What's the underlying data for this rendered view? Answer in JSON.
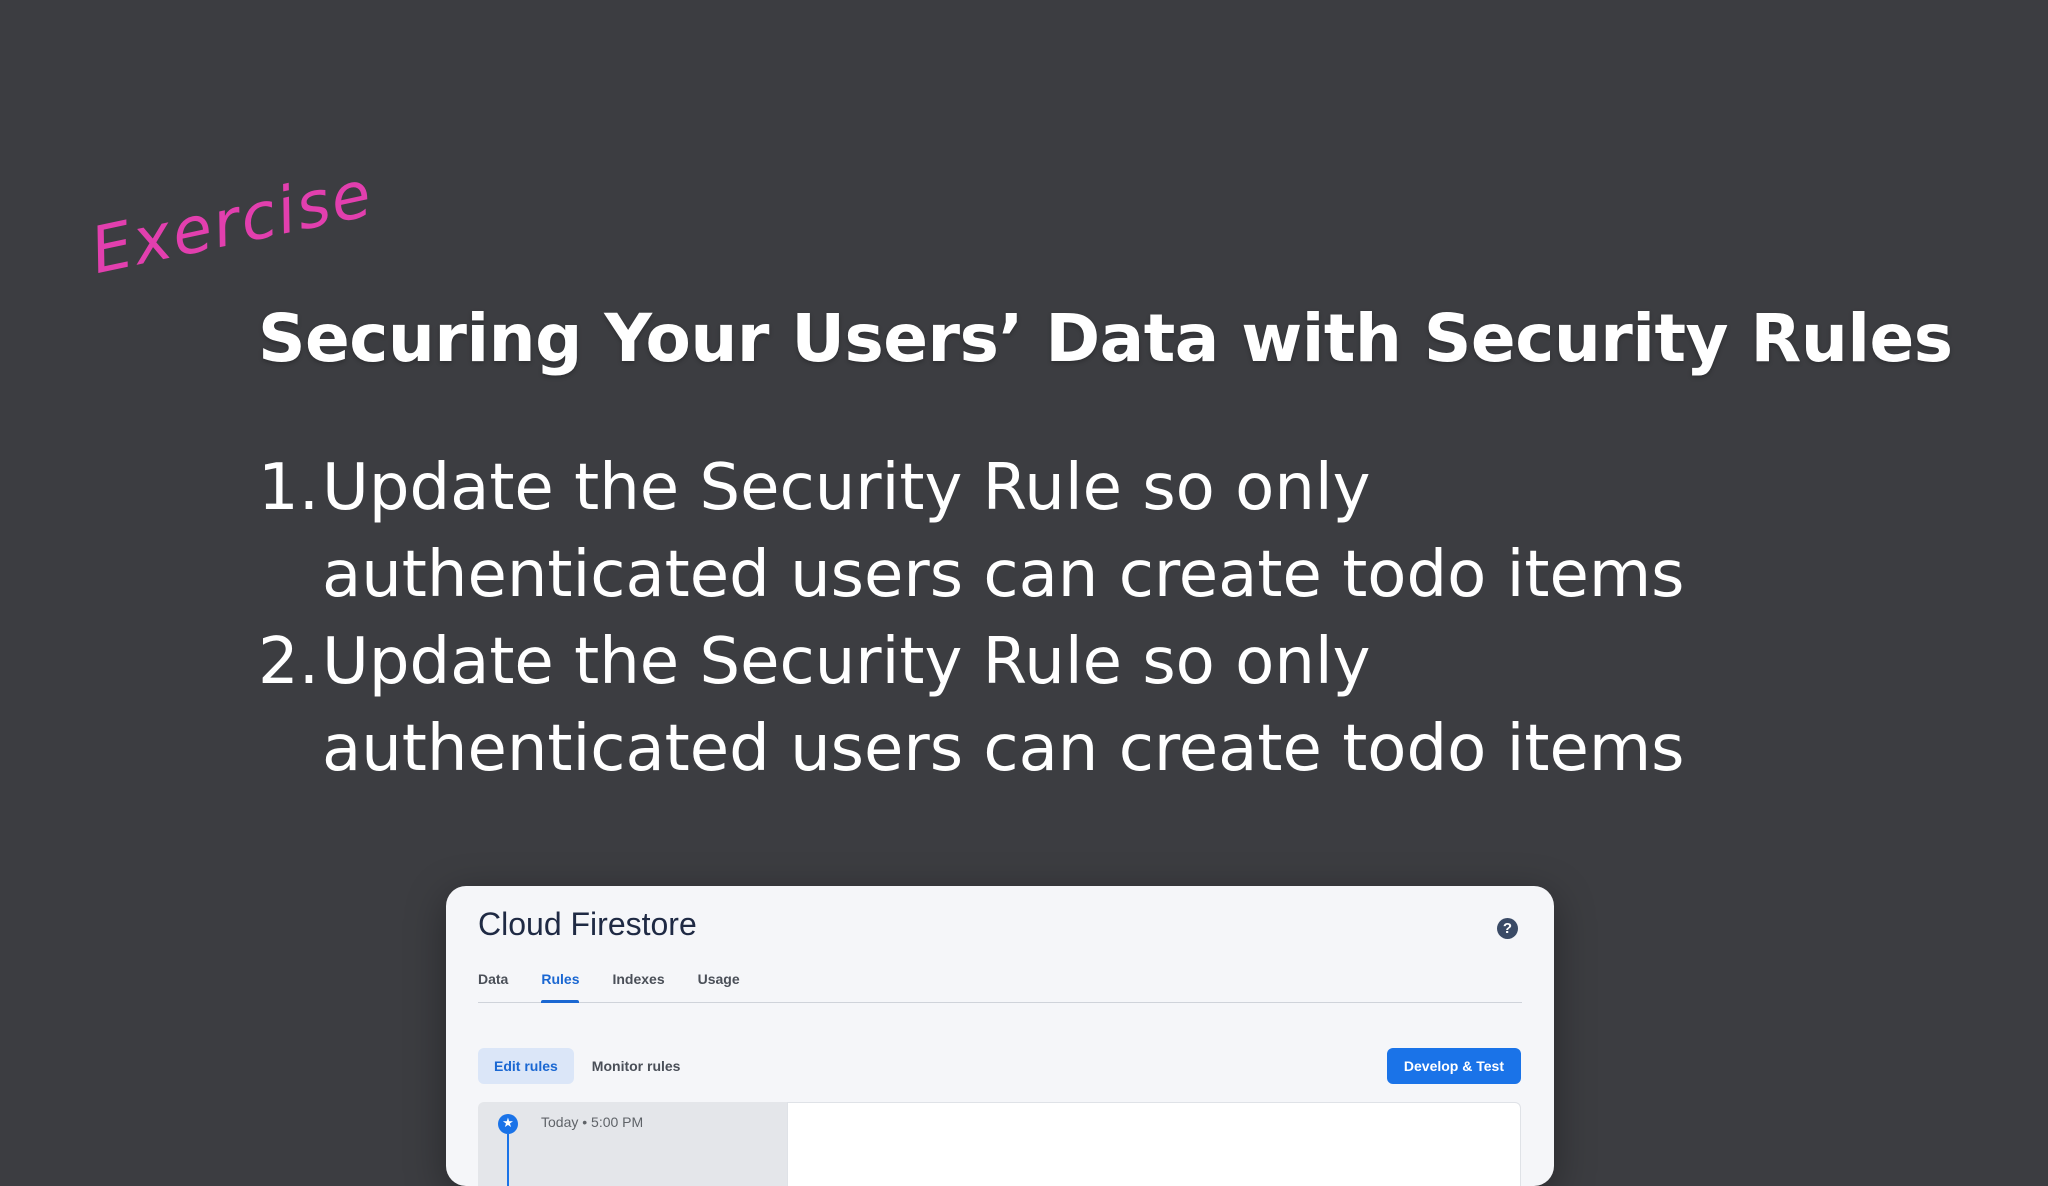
{
  "slide": {
    "tag": "Exercise",
    "title": "Securing Your Users’ Data with Security Rules",
    "steps": [
      {
        "number": "1.",
        "text": "Update the Security Rule so only authenticated users can create todo items"
      },
      {
        "number": "2.",
        "text": "Update the Security Rule so only authenticated users can create todo items"
      }
    ]
  },
  "console": {
    "title": "Cloud Firestore",
    "help_icon": "help-circle-icon",
    "tabs": [
      {
        "label": "Data",
        "active": false
      },
      {
        "label": "Rules",
        "active": true
      },
      {
        "label": "Indexes",
        "active": false
      },
      {
        "label": "Usage",
        "active": false
      }
    ],
    "subtabs": [
      {
        "label": "Edit rules",
        "active": true
      },
      {
        "label": "Monitor rules",
        "active": false
      }
    ],
    "primary_button": "Develop & Test",
    "history": {
      "icon": "star-icon",
      "time": "Today • 5:00 PM"
    }
  },
  "colors": {
    "background": "#3c3d41",
    "accent": "#e23fae",
    "primary": "#1a73e8",
    "card": "#f5f6f9"
  }
}
